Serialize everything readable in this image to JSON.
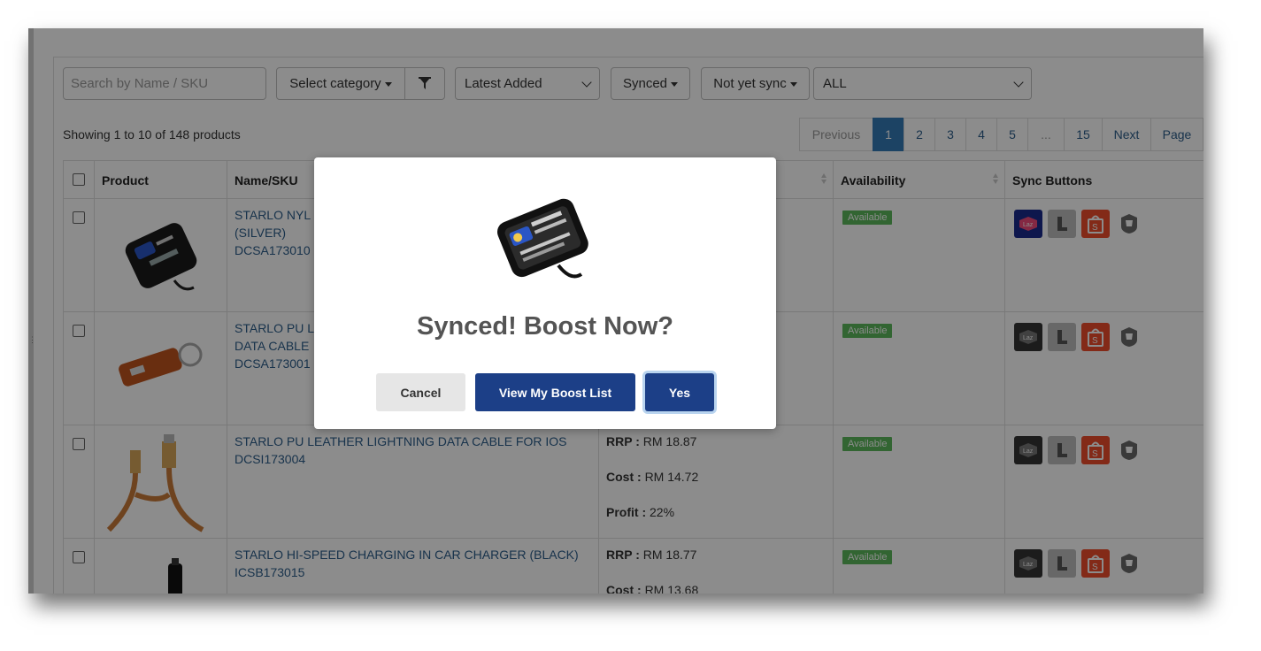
{
  "toolbar": {
    "search_placeholder": "Search by Name / SKU",
    "category_label": "Select category",
    "sort_value": "Latest Added",
    "synced_label": "Synced",
    "not_synced_label": "Not yet sync",
    "status_value": "ALL"
  },
  "summary": "Showing 1 to 10 of 148 products",
  "pagination": {
    "previous": "Previous",
    "pages": [
      "1",
      "2",
      "3",
      "4",
      "5",
      "...",
      "15"
    ],
    "active": "1",
    "next": "Next",
    "last": "Page"
  },
  "table": {
    "headers": {
      "product": "Product",
      "name_sku": "Name/SKU",
      "availability": "Availability",
      "sync_buttons": "Sync Buttons"
    },
    "rows": [
      {
        "name": "STARLO NYL",
        "name2": "(SILVER)",
        "sku": "DCSA173010",
        "availability": "Available",
        "rrp": "",
        "cost": "",
        "profit": ""
      },
      {
        "name": "STARLO PU L",
        "name2": "DATA CABLE",
        "sku": "DCSA173001",
        "availability": "Available",
        "rrp": "",
        "cost": "",
        "profit": ""
      },
      {
        "name": "STARLO PU LEATHER LIGHTNING DATA CABLE FOR IOS",
        "name2": "",
        "sku": "DCSI173004",
        "availability": "Available",
        "rrp": "RM 18.87",
        "cost": "RM 14.72",
        "profit": "22%"
      },
      {
        "name": "STARLO HI-SPEED CHARGING IN CAR CHARGER (BLACK)",
        "name2": "",
        "sku": "ICSB173015",
        "availability": "Available",
        "rrp": "RM 18.77",
        "cost": "RM 13.68",
        "profit": ""
      }
    ],
    "labels": {
      "rrp": "RRP :",
      "cost": "Cost :",
      "profit": "Profit :"
    }
  },
  "modal": {
    "title": "Synced! Boost Now?",
    "cancel": "Cancel",
    "view_boost": "View My Boost List",
    "yes": "Yes"
  },
  "sync_icons": [
    "lazada-icon",
    "lelong-icon",
    "shopee-icon",
    "shopify-icon"
  ],
  "colors": {
    "primary": "#1c3f87",
    "link": "#2c5d8a",
    "available": "#5cb85c",
    "shopee": "#ee4d2d",
    "lazada": "#1a2b8c"
  }
}
